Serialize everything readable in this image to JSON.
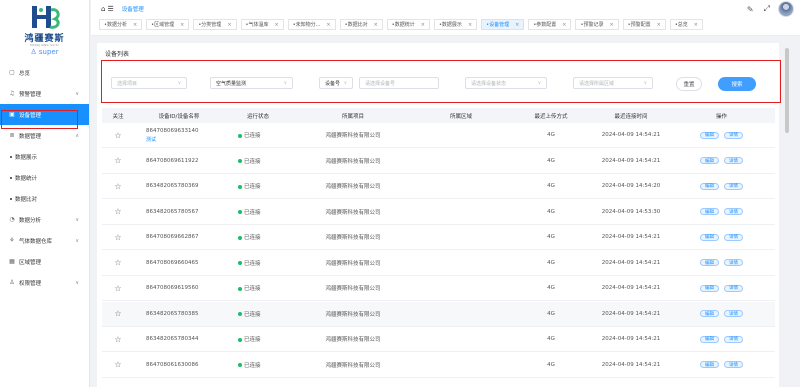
{
  "logo": {
    "name": "鸿疆赛斯",
    "sub": "HONGJIANG SAISI",
    "user": "super"
  },
  "sidebar": {
    "items": [
      {
        "label": "总览",
        "icon": "home-icon",
        "arrow": ""
      },
      {
        "label": "预警管理",
        "icon": "bell-icon",
        "arrow": "∨"
      },
      {
        "label": "设备管理",
        "icon": "device-icon",
        "arrow": ""
      },
      {
        "label": "数据管理",
        "icon": "database-icon",
        "arrow": "∧"
      },
      {
        "label": "数据展示",
        "icon": "",
        "arrow": ""
      },
      {
        "label": "数据统计",
        "icon": "",
        "arrow": ""
      },
      {
        "label": "数据比对",
        "icon": "",
        "arrow": ""
      },
      {
        "label": "数据分析",
        "icon": "chart-icon",
        "arrow": "∨"
      },
      {
        "label": "气体数据仓库",
        "icon": "warehouse-icon",
        "arrow": "∨"
      },
      {
        "label": "区域管理",
        "icon": "area-icon",
        "arrow": ""
      },
      {
        "label": "权限管理",
        "icon": "user-icon",
        "arrow": "∨"
      }
    ]
  },
  "topbar": {
    "breadcrumb": "设备管理",
    "tabs": [
      "数据分析",
      "区域管理",
      "分类管理",
      "气体温库",
      "未知物分...",
      "数据比对",
      "数据统计",
      "数据展示",
      "设备管理",
      "参数配置",
      "预警记录",
      "预警配置",
      "总览"
    ],
    "active_tab": "设备管理"
  },
  "card": {
    "title": "设备列表"
  },
  "filters": {
    "project_placeholder": "选择项目",
    "type_value": "空气质量监测",
    "device_no_label": "设备号",
    "device_no_placeholder": "请选择设备号",
    "status_placeholder": "请选择设备状态",
    "region_placeholder": "请选择所属区域",
    "reset_label": "重置",
    "search_label": "搜索"
  },
  "table": {
    "headers": [
      "关注",
      "设备ID/设备名称",
      "运行状态",
      "所属项目",
      "所属区域",
      "最近上传方式",
      "最近连接时间",
      "操作"
    ],
    "op_edit": "编辑",
    "op_detail": "详情",
    "rows": [
      {
        "id": "864708069633140",
        "name": "测试",
        "status": "已连接",
        "project": "鸿疆赛斯科技有限公司",
        "area": "",
        "upload": "4G",
        "time": "2024-04-09 14:54:21"
      },
      {
        "id": "864708069611922",
        "name": "",
        "status": "已连接",
        "project": "鸿疆赛斯科技有限公司",
        "area": "",
        "upload": "4G",
        "time": "2024-04-09 14:54:21"
      },
      {
        "id": "863482065780369",
        "name": "",
        "status": "已连接",
        "project": "鸿疆赛斯科技有限公司",
        "area": "",
        "upload": "4G",
        "time": "2024-04-09 14:54:20"
      },
      {
        "id": "863482065780567",
        "name": "",
        "status": "已连接",
        "project": "鸿疆赛斯科技有限公司",
        "area": "",
        "upload": "4G",
        "time": "2024-04-09 14:53:30"
      },
      {
        "id": "864708069662867",
        "name": "",
        "status": "已连接",
        "project": "鸿疆赛斯科技有限公司",
        "area": "",
        "upload": "4G",
        "time": "2024-04-09 14:54:21"
      },
      {
        "id": "864708069660465",
        "name": "",
        "status": "已连接",
        "project": "鸿疆赛斯科技有限公司",
        "area": "",
        "upload": "4G",
        "time": "2024-04-09 14:54:21"
      },
      {
        "id": "864708069619560",
        "name": "",
        "status": "已连接",
        "project": "鸿疆赛斯科技有限公司",
        "area": "",
        "upload": "4G",
        "time": "2024-04-09 14:54:21"
      },
      {
        "id": "863482065780385",
        "name": "",
        "status": "已连接",
        "project": "鸿疆赛斯科技有限公司",
        "area": "",
        "upload": "4G",
        "time": "2024-04-09 14:54:21"
      },
      {
        "id": "863482065780344",
        "name": "",
        "status": "已连接",
        "project": "鸿疆赛斯科技有限公司",
        "area": "",
        "upload": "4G",
        "time": "2024-04-09 14:54:21"
      },
      {
        "id": "864708061630086",
        "name": "",
        "status": "已连接",
        "project": "鸿疆赛斯科技有限公司",
        "area": "",
        "upload": "4G",
        "time": "2024-04-09 14:54:21"
      }
    ]
  },
  "colors": {
    "primary": "#1890ff",
    "highlight": "#e02020",
    "status_ok": "#19be6b"
  }
}
